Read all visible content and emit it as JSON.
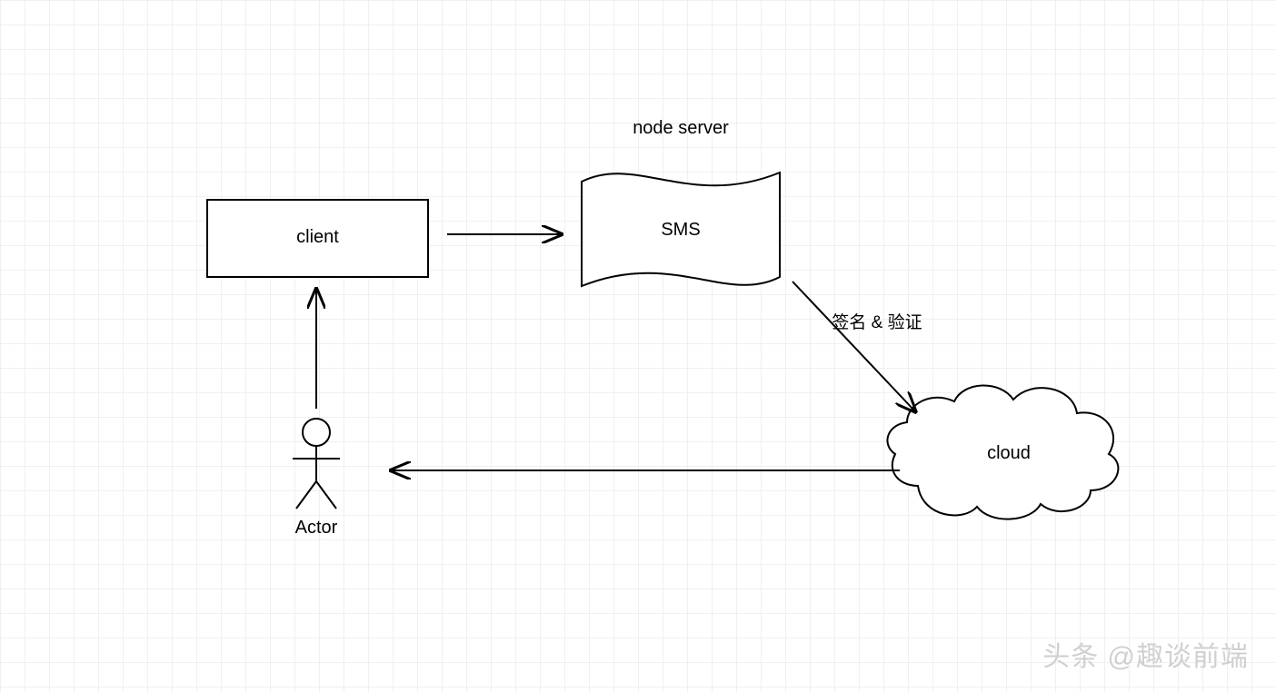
{
  "nodes": {
    "client": "client",
    "sms": "SMS",
    "node_server": "node server",
    "cloud": "cloud",
    "actor": "Actor"
  },
  "edges": {
    "sign_verify": "签名 & 验证"
  },
  "watermark": "头条 @趣谈前端"
}
